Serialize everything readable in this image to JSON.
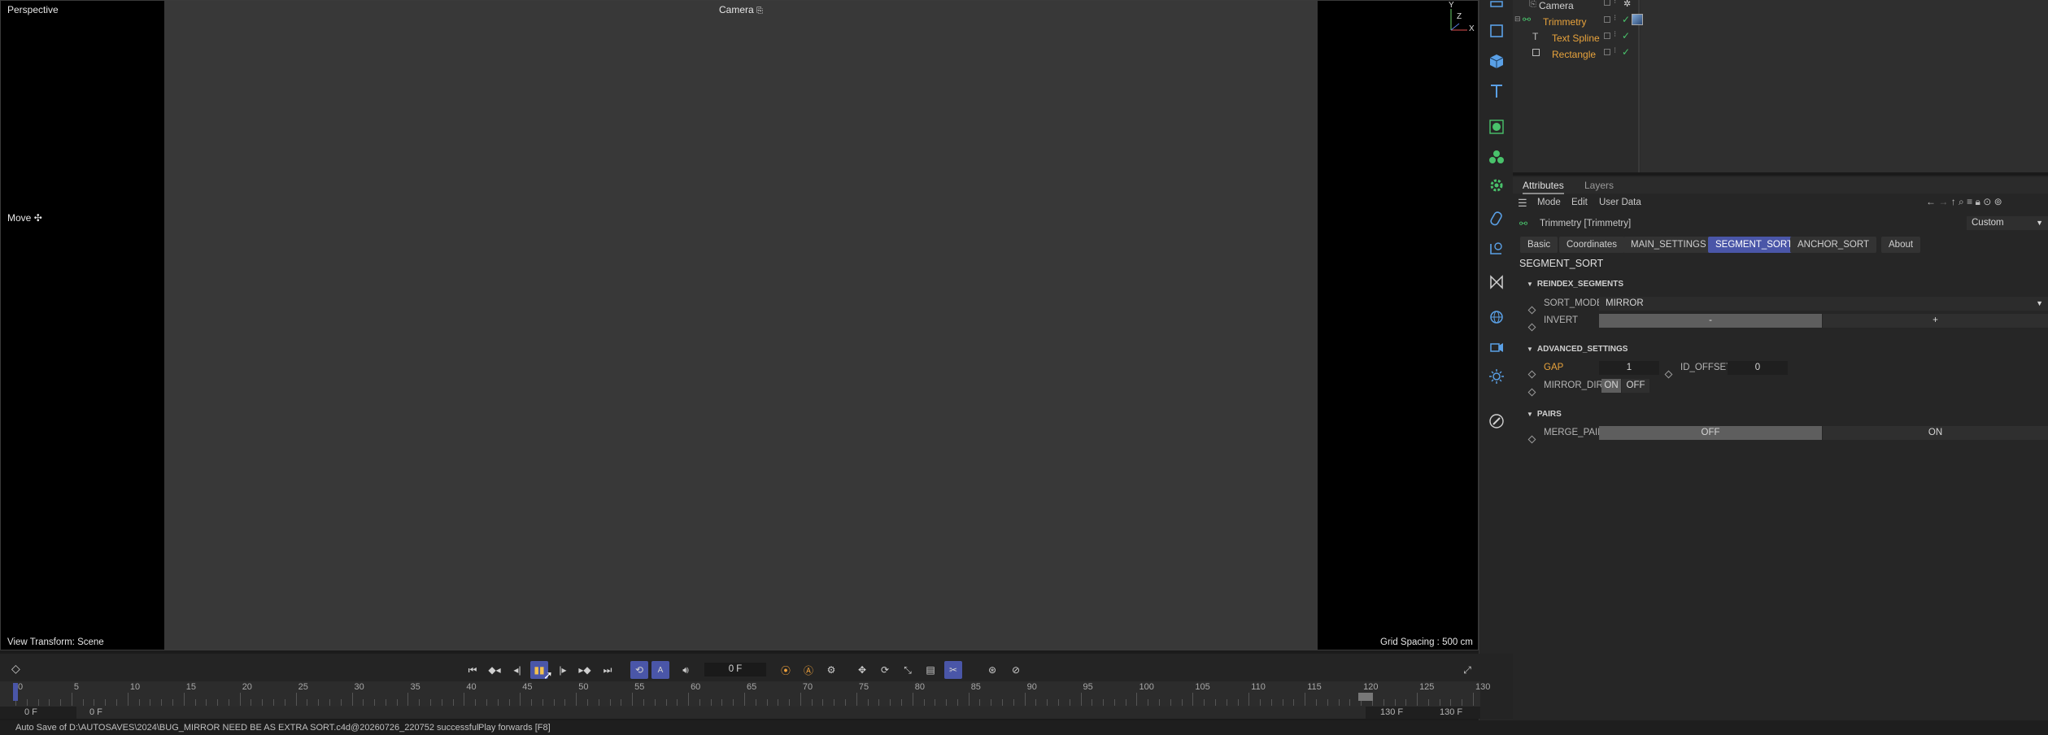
{
  "viewport": {
    "view_name": "Perspective",
    "camera_label": "Camera",
    "move_label": "Move",
    "view_transform": "View Transform: Scene",
    "grid_spacing": "Grid Spacing : 500 cm",
    "axis_y": "Y",
    "axis_z": "Z",
    "axis_x": "X"
  },
  "objects": [
    {
      "name": "Camera",
      "color": "#cfcfcf"
    },
    {
      "name": "Trimmetry",
      "color": "#e8a33c"
    },
    {
      "name": "Text Spline",
      "color": "#e8a33c"
    },
    {
      "name": "Rectangle",
      "color": "#e8a33c"
    }
  ],
  "attributes": {
    "tabs": [
      "Attributes",
      "Layers"
    ],
    "menu": [
      "Mode",
      "Edit",
      "User Data"
    ],
    "object_title": "Trimmetry [Trimmetry]",
    "preset": "Custom",
    "pill_tabs": [
      "Basic",
      "Coordinates",
      "MAIN_SETTINGS",
      "SEGMENT_SORT",
      "ANCHOR_SORT",
      "About"
    ],
    "active_tab": "SEGMENT_SORT",
    "section_title": "SEGMENT_SORT",
    "groups": {
      "reindex": "REINDEX_SEGMENTS",
      "advanced": "ADVANCED_SETTINGS",
      "pairs": "PAIRS"
    },
    "sort_mode_label": "SORT_MODE",
    "sort_mode_value": "MIRROR",
    "invert_label": "INVERT",
    "invert_minus": "-",
    "invert_plus": "+",
    "gap_label": "GAP",
    "gap_value": "1",
    "id_offset_label": "ID_OFFSET",
    "id_offset_value": "0",
    "mirror_dir_label": "MIRROR_DIR",
    "mirror_on": "ON",
    "mirror_off": "OFF",
    "merge_pair_label": "MERGE_PAIR",
    "merge_off": "OFF",
    "merge_on": "ON"
  },
  "timeline": {
    "current_frame": "0 F",
    "start_frame": "0 F",
    "start_preview": "0 F",
    "end_preview": "130 F",
    "end_frame": "130 F",
    "ticks": [
      "0",
      "5",
      "10",
      "15",
      "20",
      "25",
      "30",
      "35",
      "40",
      "45",
      "50",
      "55",
      "60",
      "65",
      "70",
      "75",
      "80",
      "85",
      "90",
      "95",
      "100",
      "105",
      "110",
      "115",
      "120",
      "125",
      "130"
    ]
  },
  "status": {
    "message": "Auto Save of D:\\AUTOSAVES\\2024\\BUG_MIRROR NEED BE AS EXTRA SORT.c4d@20260726_220752 successful",
    "hint": "Play forwards [F8]"
  },
  "colors": {
    "accent": "#4a56a8",
    "object_orange": "#e8a33c",
    "check_green": "#49c26b"
  }
}
